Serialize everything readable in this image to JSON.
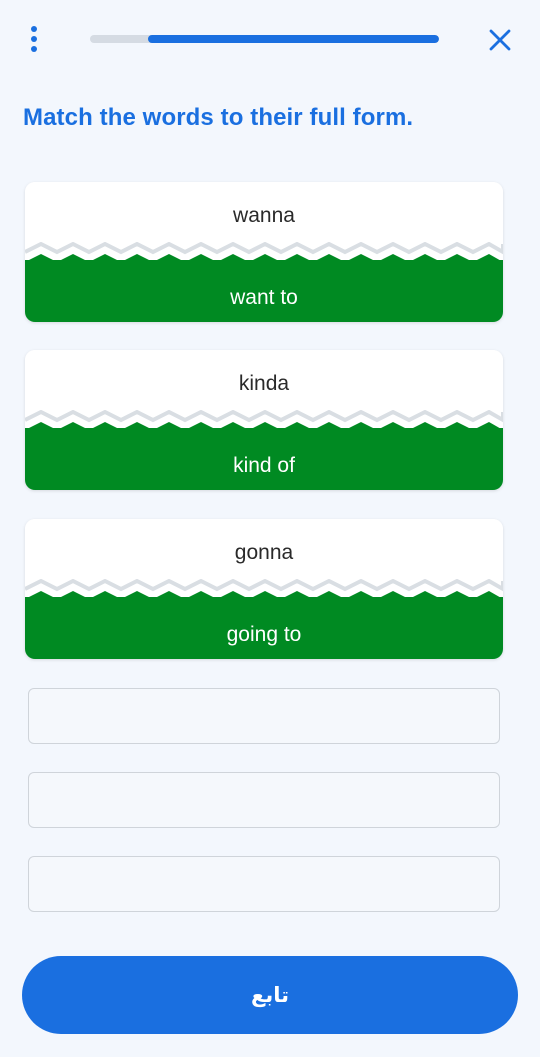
{
  "header": {
    "progress_fraction": 0.667,
    "menu_icon": "more-vertical-icon",
    "close_icon": "close-icon"
  },
  "prompt": "Match the words to their full form.",
  "pairs": [
    {
      "word": "wanna",
      "full_form": "want to"
    },
    {
      "word": "kinda",
      "full_form": "kind of"
    },
    {
      "word": "gonna",
      "full_form": "going to"
    }
  ],
  "answer_slots": [
    "",
    "",
    ""
  ],
  "continue_label": "تابع",
  "colors": {
    "accent": "#1a6fe0",
    "matched": "#008a22",
    "background": "#f3f7fd"
  }
}
